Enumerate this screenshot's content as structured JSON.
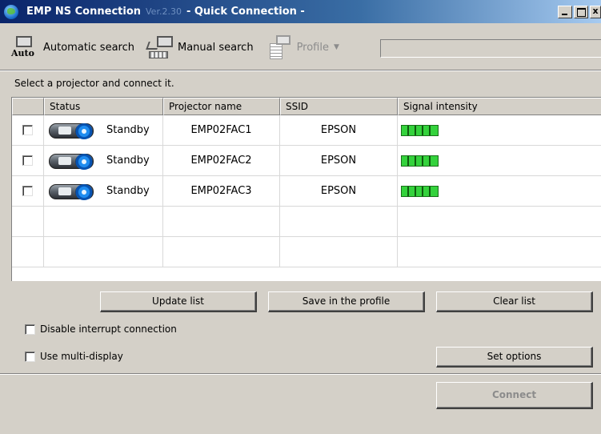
{
  "window": {
    "title_main": "EMP NS Connection",
    "title_version": "Ver.2.30",
    "title_rest": "- Quick Connection -",
    "minimize_label": "",
    "maximize_label": "",
    "close_label": "x"
  },
  "toolbar": {
    "auto_icon_text": "Auto",
    "automatic_search": "Automatic search",
    "manual_search": "Manual search",
    "profile": "Profile",
    "profile_dropdown": "▼"
  },
  "instruction": "Select a projector and connect it.",
  "table": {
    "headers": [
      "Status",
      "Projector name",
      "SSID",
      "Signal intensity"
    ],
    "rows": [
      {
        "status": "Standby",
        "name": "EMP02FAC1",
        "ssid": "EPSON",
        "signal_bars": 5
      },
      {
        "status": "Standby",
        "name": "EMP02FAC2",
        "ssid": "EPSON",
        "signal_bars": 5
      },
      {
        "status": "Standby",
        "name": "EMP02FAC3",
        "ssid": "EPSON",
        "signal_bars": 5
      }
    ]
  },
  "buttons": {
    "update_list": "Update list",
    "save_profile": "Save in the profile",
    "clear_list": "Clear list",
    "set_options": "Set options",
    "connect": "Connect"
  },
  "options": {
    "disable_interrupt": "Disable interrupt connection",
    "multi_display": "Use multi-display"
  },
  "colors": {
    "signal_green": "#34d23c",
    "titlebar_start": "#0a246a",
    "window_face": "#d4d0c8"
  }
}
